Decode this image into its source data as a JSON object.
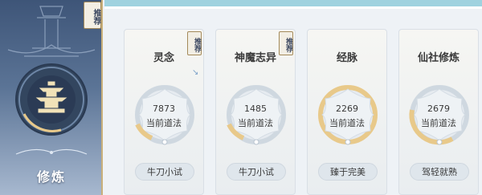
{
  "left": {
    "corner_tag": "推荐",
    "label": "修炼"
  },
  "cards": [
    {
      "title": "灵念",
      "tag": "",
      "value": "7873",
      "sub": "当前道法",
      "rank": "牛刀小试",
      "progress": 0.15
    },
    {
      "title": "神魔志异",
      "tag": "推荐",
      "value": "1485",
      "sub": "当前道法",
      "rank": "牛刀小试",
      "progress": 0.15
    },
    {
      "title": "经脉",
      "tag": "",
      "value": "2269",
      "sub": "当前道法",
      "rank": "臻于完美",
      "progress": 1.0
    },
    {
      "title": "仙社修炼",
      "tag": "",
      "value": "2679",
      "sub": "当前道法",
      "rank": "驾轻就熟",
      "progress": 0.6
    }
  ],
  "first_card_tag": "推荐",
  "colors": {
    "panel_top": "#3e5578",
    "accent_gold": "#c9b07a",
    "teal_bar": "#9fd2df"
  },
  "icons": {
    "main": "pagoda-emblem-icon",
    "ornament": "cloud-ornament-icon"
  }
}
